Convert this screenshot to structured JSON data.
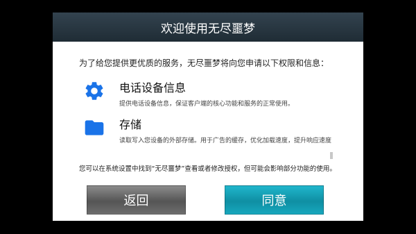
{
  "dialog": {
    "title": "欢迎使用无尽噩梦",
    "intro": "为了给您提供更优质的服务，无尽噩梦将向您申请以下权限和信息：",
    "permissions": [
      {
        "icon": "settings-gear-icon",
        "title": "电话设备信息",
        "desc": "提供电话设备信息，保证客户端的核心功能和服务的正常使用。",
        "color": "#1a73e8"
      },
      {
        "icon": "folder-icon",
        "title": "存储",
        "desc": "读取写入您设备的外部存储。用于广告的缓存，优化加载速度，提升响应速度",
        "color": "#1a73e8"
      }
    ],
    "note": "您可以在系统设置中找到“无尽噩梦”查看或者修改授权，但可能会影响部分功能的使用。",
    "buttons": {
      "back": "返回",
      "agree": "同意"
    }
  },
  "colors": {
    "accent": "#1a73e8",
    "agree_button": "#14a1b6",
    "header": "#2a3a45"
  }
}
